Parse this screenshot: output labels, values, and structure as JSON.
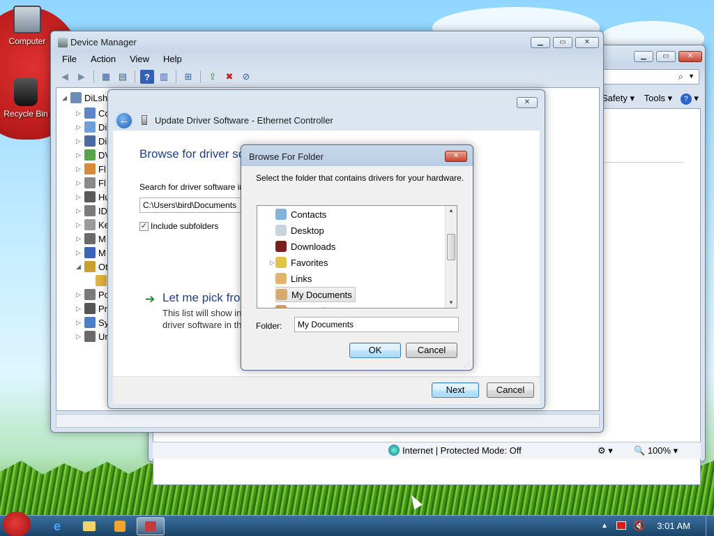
{
  "desktop": {
    "icons": [
      {
        "label": "Computer",
        "icon": "computer-icon"
      },
      {
        "label": "Recycle Bin",
        "icon": "recycle-bin-icon"
      }
    ]
  },
  "ie_window": {
    "toolbar_items": [
      "Safety",
      "Tools"
    ],
    "status": {
      "zone": "Internet | Protected Mode: Off",
      "zoom": "100%"
    }
  },
  "device_manager": {
    "title": "Device Manager",
    "menu": [
      "File",
      "Action",
      "View",
      "Help"
    ],
    "tree": {
      "root": "DiLsh",
      "items": [
        "Co",
        "Di",
        "Di",
        "DV",
        "Fl",
        "Fl",
        "Hu",
        "ID",
        "Ke",
        "M",
        "M",
        "Ot",
        "",
        "Po",
        "Pr",
        "Sy",
        "Ur"
      ]
    }
  },
  "update_wizard": {
    "title": "Update Driver Software - Ethernet Controller",
    "heading": "Browse for driver so",
    "search_label": "Search for driver software in",
    "path_value": "C:\\Users\\bird\\Documents",
    "include_subfolders_label": "Include subfolders",
    "include_subfolders_checked": true,
    "pick_heading": "Let me pick fro",
    "pick_desc_line1": "This list will show in",
    "pick_desc_line2": "driver software in th",
    "next_label": "Next",
    "cancel_label": "Cancel"
  },
  "browse_folder": {
    "title": "Browse For Folder",
    "instruction": "Select the folder that contains drivers for your hardware.",
    "folders": [
      {
        "label": "Contacts",
        "icon": "contacts-icon",
        "expandable": false,
        "selected": false
      },
      {
        "label": "Desktop",
        "icon": "desktop-folder-icon",
        "expandable": false,
        "selected": false
      },
      {
        "label": "Downloads",
        "icon": "downloads-icon",
        "expandable": false,
        "selected": false
      },
      {
        "label": "Favorites",
        "icon": "favorites-icon",
        "expandable": true,
        "selected": false
      },
      {
        "label": "Links",
        "icon": "links-icon",
        "expandable": false,
        "selected": false
      },
      {
        "label": "My Documents",
        "icon": "my-documents-icon",
        "expandable": false,
        "selected": true
      },
      {
        "label": "My Music",
        "icon": "my-music-icon",
        "expandable": false,
        "selected": false
      }
    ],
    "folder_label": "Folder:",
    "folder_value": "My Documents",
    "ok_label": "OK",
    "cancel_label": "Cancel"
  },
  "taskbar": {
    "clock": "3:01 AM"
  },
  "colors": {
    "heading_blue": "#1e3f8a",
    "link_green": "#1f8a2e",
    "taskbar": "#2b5c86"
  }
}
